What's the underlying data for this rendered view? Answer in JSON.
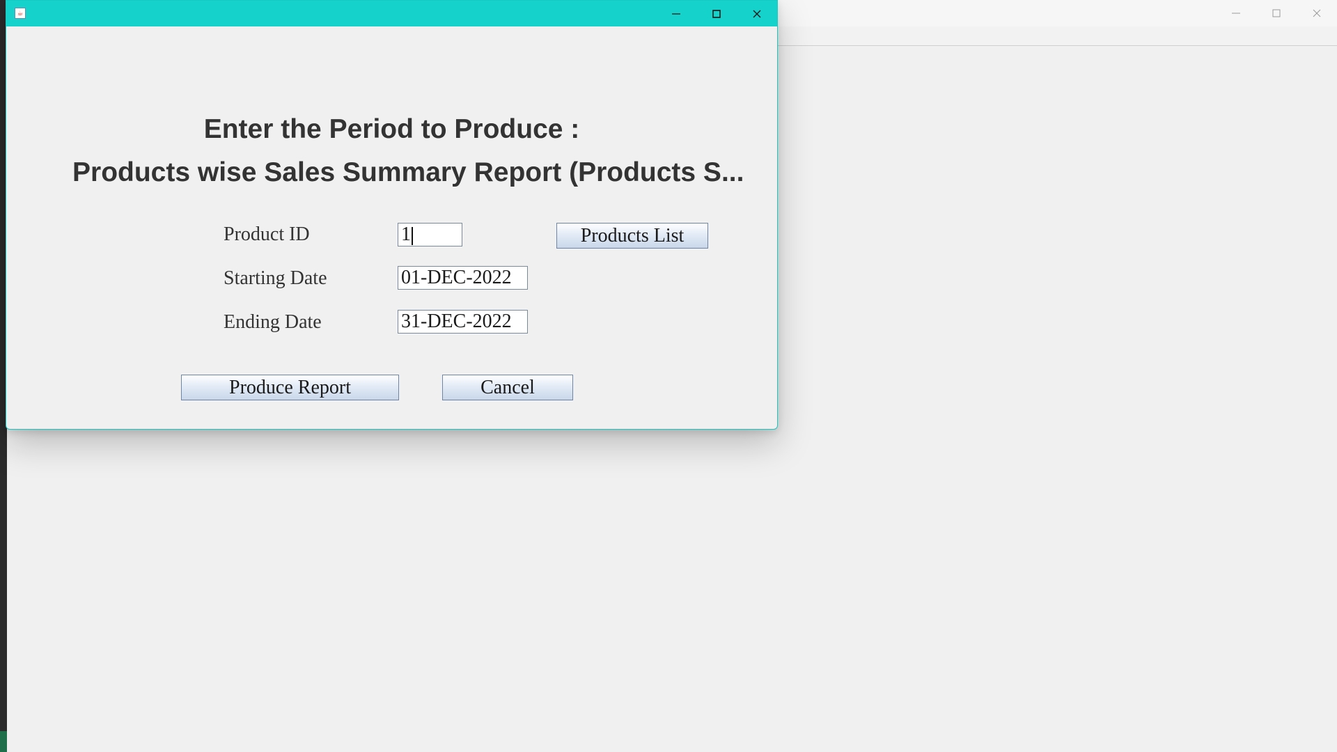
{
  "background_window": {
    "controls": [
      "minimize-icon",
      "maximize-icon",
      "close-icon"
    ]
  },
  "dialog": {
    "title_icon": "java-app-icon",
    "controls": [
      "minimize-icon",
      "maximize-icon",
      "close-icon"
    ],
    "heading_line1": "Enter the Period to Produce :",
    "heading_line2": "Products wise Sales Summary Report (Products S...",
    "fields": {
      "product_id": {
        "label": "Product ID",
        "value": "1"
      },
      "starting_date": {
        "label": "Starting Date",
        "value": "01-DEC-2022"
      },
      "ending_date": {
        "label": "Ending Date",
        "value": "31-DEC-2022"
      }
    },
    "buttons": {
      "products_list": "Products List",
      "produce_report": "Produce Report",
      "cancel": "Cancel"
    }
  },
  "colors": {
    "dialog_titlebar": "#15d2cb",
    "background": "#f0f0f0",
    "heading_text": "#333333"
  }
}
